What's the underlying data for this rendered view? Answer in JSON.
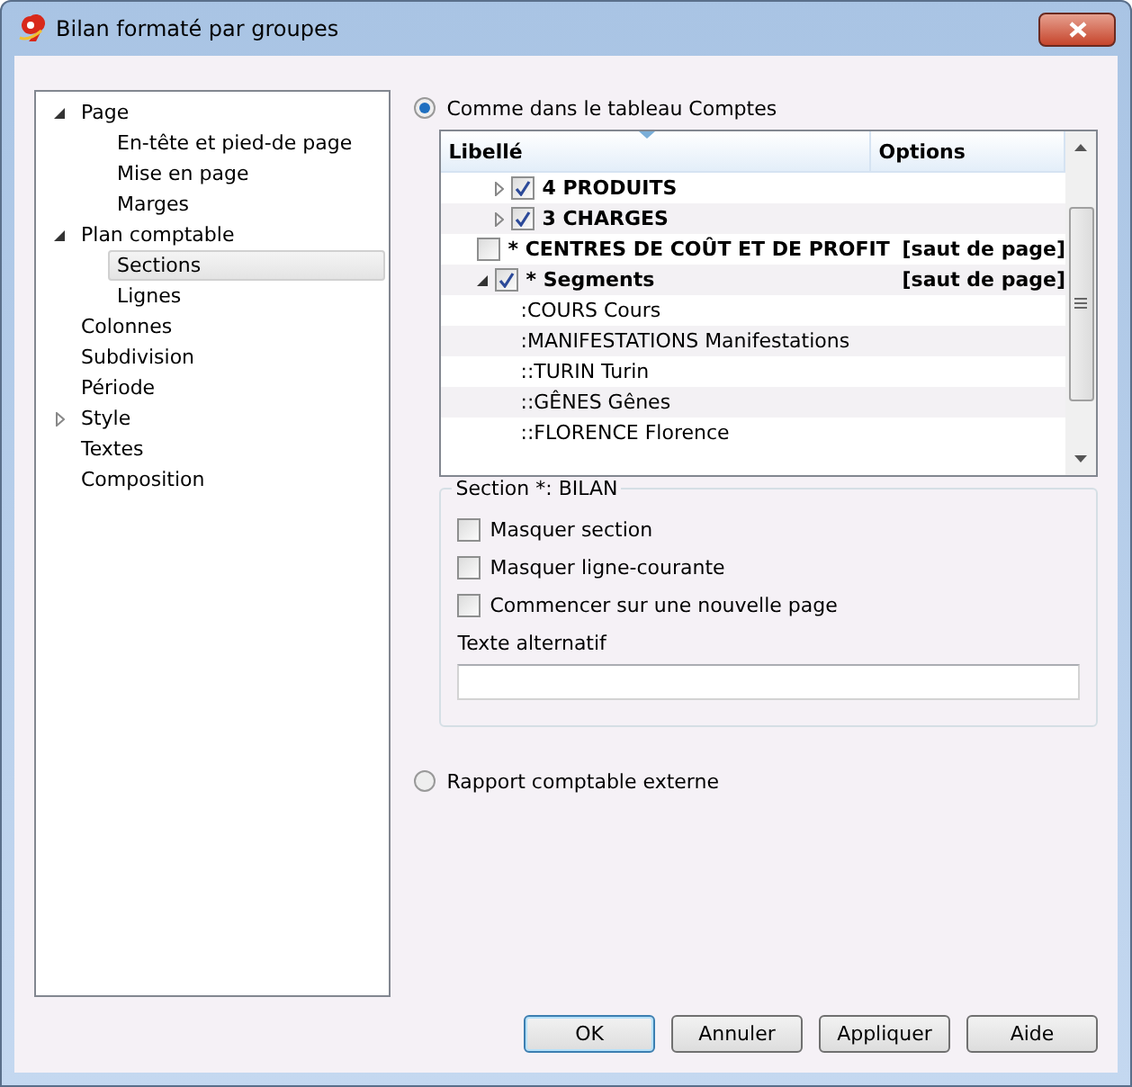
{
  "window": {
    "title": "Bilan formaté par groupes"
  },
  "tree": [
    {
      "label": "Page",
      "expanded": true,
      "selected": false,
      "children": [
        {
          "label": "En-tête et pied-de page",
          "selected": false
        },
        {
          "label": "Mise en page",
          "selected": false
        },
        {
          "label": "Marges",
          "selected": false
        }
      ]
    },
    {
      "label": "Plan comptable",
      "expanded": true,
      "selected": false,
      "children": [
        {
          "label": "Sections",
          "selected": true
        },
        {
          "label": "Lignes",
          "selected": false
        }
      ]
    },
    {
      "label": "Colonnes",
      "selected": false
    },
    {
      "label": "Subdivision",
      "selected": false
    },
    {
      "label": "Période",
      "selected": false
    },
    {
      "label": "Style",
      "expanded": false,
      "selected": false
    },
    {
      "label": "Textes",
      "selected": false
    },
    {
      "label": "Composition",
      "selected": false
    }
  ],
  "source_options": [
    {
      "label": "Comme dans le tableau Comptes",
      "selected": true
    },
    {
      "label": "Rapport comptable externe",
      "selected": false
    }
  ],
  "table": {
    "columns": [
      "Libellé",
      "Options"
    ],
    "rows": [
      {
        "label": "4 PRODUITS",
        "bold": true,
        "expanded": false,
        "checked": true
      },
      {
        "label": "3 CHARGES",
        "bold": true,
        "expanded": false,
        "checked": true
      },
      {
        "label": "* CENTRES DE COÛT ET DE PROFIT",
        "bold": true,
        "checked": false,
        "option": "[saut de page]"
      },
      {
        "label": "* Segments",
        "bold": true,
        "expanded": true,
        "checked": true,
        "option": "[saut de page]"
      },
      {
        "label": ":COURS Cours",
        "bold": false
      },
      {
        "label": ":MANIFESTATIONS Manifestations",
        "bold": false
      },
      {
        "label": "::TURIN Turin",
        "bold": false
      },
      {
        "label": "::GÊNES Gênes",
        "bold": false
      },
      {
        "label": "::FLORENCE Florence",
        "bold": false
      }
    ]
  },
  "section": {
    "title": "Section *: BILAN",
    "checks": [
      {
        "label": "Masquer section",
        "checked": false
      },
      {
        "label": "Masquer ligne-courante",
        "checked": false
      },
      {
        "label": "Commencer sur une nouvelle page",
        "checked": false
      }
    ],
    "alt_label": "Texte alternatif"
  },
  "buttons": [
    {
      "label": "OK",
      "default": true
    },
    {
      "label": "Annuler",
      "default": false
    },
    {
      "label": "Appliquer",
      "default": false
    },
    {
      "label": "Aide",
      "default": false
    }
  ]
}
